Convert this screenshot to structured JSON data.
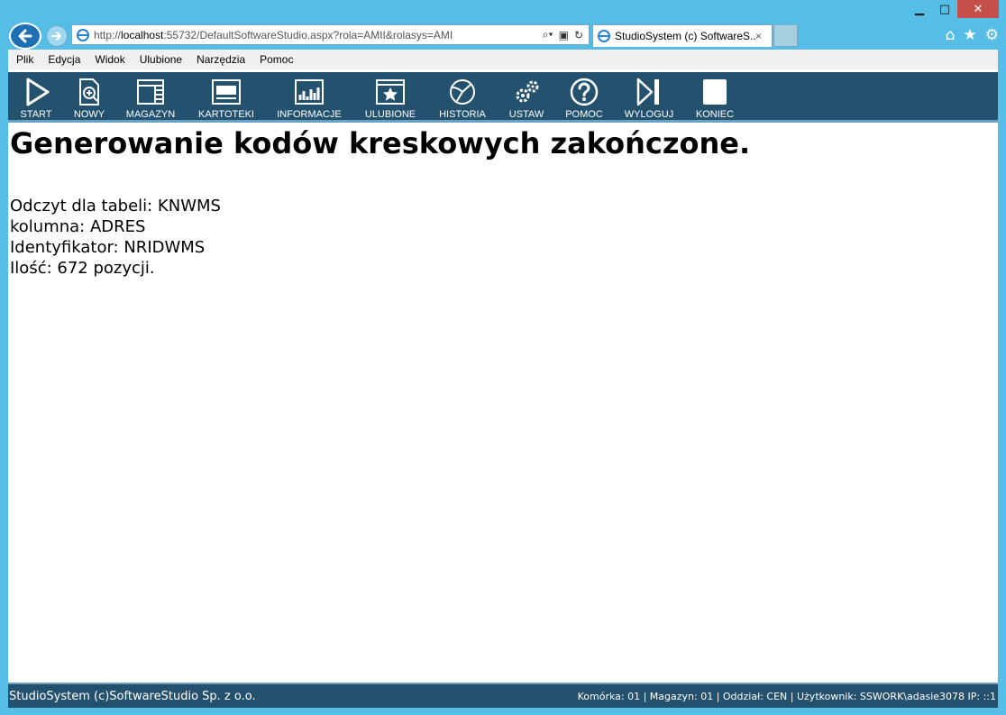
{
  "window": {
    "minimize": "▁",
    "maximize": "□",
    "close": "✕"
  },
  "browser": {
    "url_prefix": "http://",
    "url_host": "localhost",
    "url_rest": ":55732/DefaultSoftwareStudio.aspx?rola=AMII&rolasys=AMI",
    "tab_title": "StudioSystem (c) SoftwareS...",
    "tab_close": "×"
  },
  "menu": [
    "Plik",
    "Edycja",
    "Widok",
    "Ulubione",
    "Narzędzia",
    "Pomoc"
  ],
  "toolbar": [
    {
      "label": "START",
      "icon": "play-icon"
    },
    {
      "label": "NOWY",
      "icon": "new-document-icon"
    },
    {
      "label": "MAGAZYN",
      "icon": "warehouse-icon"
    },
    {
      "label": "KARTOTEKI",
      "icon": "records-icon"
    },
    {
      "label": "INFORMACJE",
      "icon": "info-chart-icon"
    },
    {
      "label": "ULUBIONE",
      "icon": "favorites-icon"
    },
    {
      "label": "HISTORIA",
      "icon": "history-icon"
    },
    {
      "label": "USTAW",
      "icon": "settings-gears-icon"
    },
    {
      "label": "POMOC",
      "icon": "help-icon"
    },
    {
      "label": "WYLOGUJ",
      "icon": "logout-icon"
    },
    {
      "label": "KONIEC",
      "icon": "end-icon"
    }
  ],
  "main": {
    "heading": "Generowanie kodów kreskowych zakończone.",
    "lines": [
      "Odczyt dla tabeli: KNWMS",
      "kolumna: ADRES",
      "Identyfikator: NRIDWMS",
      "Ilość: 672 pozycji."
    ]
  },
  "footer": {
    "left": "StudioSystem (c)SoftwareStudio Sp. z o.o.",
    "right": "Komórka: 01 | Magazyn: 01 | Oddział: CEN | Użytkownik: SSWORK\\adasie3078 IP: ::1"
  },
  "colors": {
    "toolbar_bg": "#24526e",
    "frame_bg": "#56bde6"
  }
}
